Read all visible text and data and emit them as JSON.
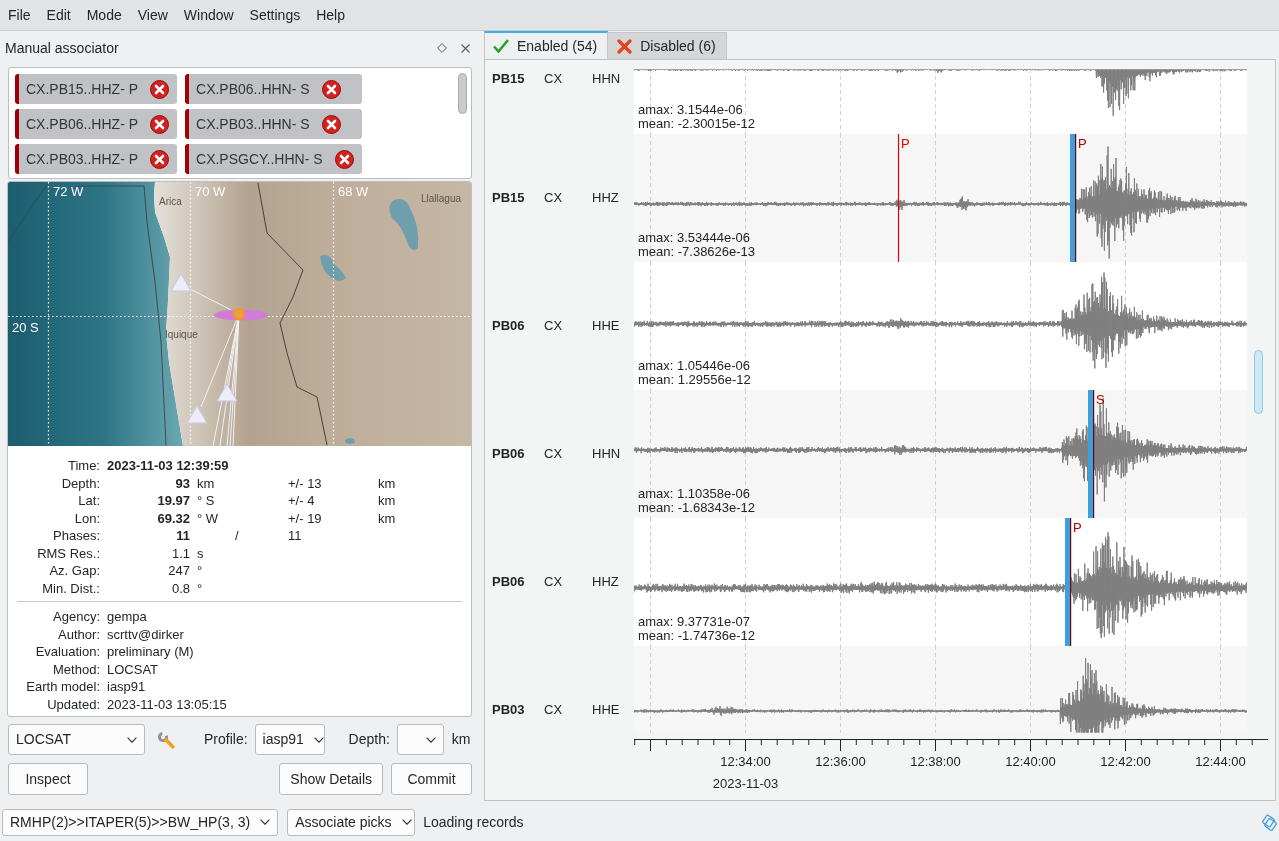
{
  "menu": [
    "File",
    "Edit",
    "Mode",
    "View",
    "Window",
    "Settings",
    "Help"
  ],
  "dock": {
    "title": "Manual associator"
  },
  "picks": [
    {
      "label": "CX.PB15..HHZ- P"
    },
    {
      "label": "CX.PB06..HHN- S"
    },
    {
      "label": "CX.PB06..HHZ- P"
    },
    {
      "label": "CX.PB03..HHN- S"
    },
    {
      "label": "CX.PB03..HHZ- P"
    },
    {
      "label": "CX.PSGCY..HHN- S"
    }
  ],
  "map": {
    "longitude_labels": [
      "72 W",
      "70 W",
      "68 W"
    ],
    "latitude_labels": [
      "20 S"
    ],
    "places": [
      "Arica",
      "Iquique",
      "Llallagua"
    ]
  },
  "origin": {
    "rows": [
      {
        "kind": "time",
        "label": "Time:",
        "value": "2023-11-03 12:39:59",
        "bold": true
      },
      {
        "kind": "measure",
        "label": "Depth:",
        "value": "93",
        "bold": true,
        "unit": "km",
        "error": "+/- 13",
        "error_unit": "km"
      },
      {
        "kind": "measure",
        "label": "Lat:",
        "value": "19.97",
        "bold": true,
        "unit": "° S",
        "error": "+/- 4",
        "error_unit": "km"
      },
      {
        "kind": "measure",
        "label": "Lon:",
        "value": "69.32",
        "bold": true,
        "unit": "° W",
        "error": "+/- 19",
        "error_unit": "km"
      },
      {
        "kind": "ratio",
        "label": "Phases:",
        "value": "11",
        "bold": true,
        "separator": "/",
        "total": "11"
      },
      {
        "kind": "measure",
        "label": "RMS Res.:",
        "value": "1.1",
        "bold": false,
        "unit": "s"
      },
      {
        "kind": "measure",
        "label": "Az. Gap:",
        "value": "247",
        "bold": false,
        "unit": "°"
      },
      {
        "kind": "measure",
        "label": "Min. Dist.:",
        "value": "0.8",
        "bold": false,
        "unit": "°"
      }
    ],
    "details": [
      {
        "label": "Agency:",
        "value": "gempa"
      },
      {
        "label": "Author:",
        "value": "scrttv@dirker"
      },
      {
        "label": "Evaluation:",
        "value": "preliminary (M)"
      },
      {
        "label": "Method:",
        "value": "LOCSAT"
      },
      {
        "label": "Earth model:",
        "value": "iasp91"
      },
      {
        "label": "Updated:",
        "value": "2023-11-03 13:05:15"
      }
    ]
  },
  "locator": {
    "method": "LOCSAT",
    "profile_label": "Profile:",
    "profile": "iasp91",
    "depth_label": "Depth:",
    "depth_unit": "km"
  },
  "actions": {
    "left": [
      "Inspect"
    ],
    "right": [
      "Show Details",
      "Commit"
    ]
  },
  "tabs": [
    {
      "label": "Enabled (54)",
      "selected": true,
      "kind": "enabled"
    },
    {
      "label": "Disabled (6)",
      "selected": false,
      "kind": "disabled"
    }
  ],
  "traces": [
    {
      "station": "PB15",
      "network": "CX",
      "channel": "HHN",
      "amax": "amax: 3.1544e-06",
      "mean": "mean: -2.30015e-12"
    },
    {
      "station": "PB15",
      "network": "CX",
      "channel": "HHZ",
      "amax": "amax: 3.53444e-06",
      "mean": "mean: -7.38626e-13",
      "picks": [
        {
          "kind": "arrival",
          "label": "P"
        },
        {
          "kind": "pick",
          "label": "P"
        }
      ]
    },
    {
      "station": "PB06",
      "network": "CX",
      "channel": "HHE",
      "amax": "amax: 1.05446e-06",
      "mean": "mean: 1.29556e-12"
    },
    {
      "station": "PB06",
      "network": "CX",
      "channel": "HHN",
      "amax": "amax: 1.10358e-06",
      "mean": "mean: -1.68343e-12",
      "picks": [
        {
          "kind": "pick",
          "label": "S"
        }
      ]
    },
    {
      "station": "PB06",
      "network": "CX",
      "channel": "HHZ",
      "amax": "amax: 9.37731e-07",
      "mean": "mean: -1.74736e-12",
      "picks": [
        {
          "kind": "pick",
          "label": "P"
        }
      ]
    },
    {
      "station": "PB03",
      "network": "CX",
      "channel": "HHE"
    }
  ],
  "time_axis": {
    "ticks": [
      "12:34:00",
      "12:36:00",
      "12:38:00",
      "12:40:00",
      "12:42:00",
      "12:44:00"
    ],
    "date": "2023-11-03"
  },
  "status_bar": {
    "filter": "RMHP(2)>>ITAPER(5)>>BW_HP(3, 3)",
    "mode": "Associate picks",
    "message": "Loading records"
  }
}
